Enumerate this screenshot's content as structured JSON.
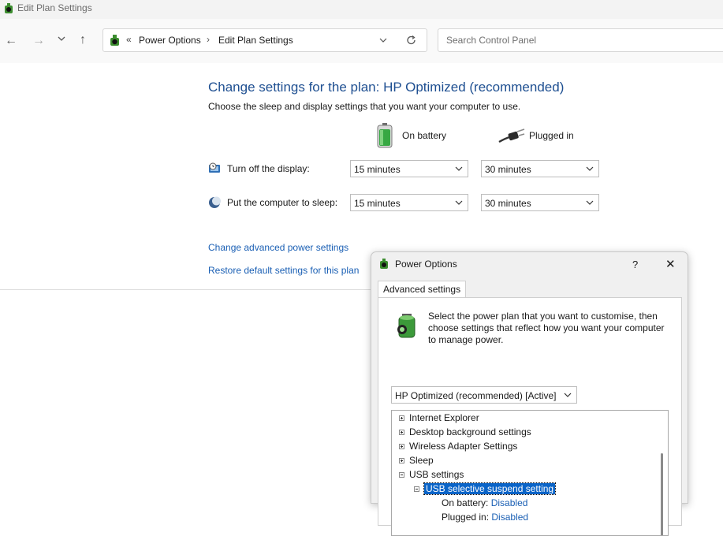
{
  "window": {
    "title": "Edit Plan Settings"
  },
  "nav": {
    "breadcrumb": [
      "Power Options",
      "Edit Plan Settings"
    ],
    "breadcrumb_chevron": "«",
    "breadcrumb_separator": "›",
    "search_placeholder": "Search Control Panel"
  },
  "main": {
    "heading": "Change settings for the plan: HP Optimized (recommended)",
    "subheading": "Choose the sleep and display settings that you want your computer to use.",
    "col_battery": "On battery",
    "col_plugged": "Plugged in",
    "rows": [
      {
        "label": "Turn off the display:",
        "battery": "15 minutes",
        "plugged": "30 minutes"
      },
      {
        "label": "Put the computer to sleep:",
        "battery": "15 minutes",
        "plugged": "30 minutes"
      }
    ],
    "link_advanced": "Change advanced power settings",
    "link_restore": "Restore default settings for this plan"
  },
  "dialog": {
    "title": "Power Options",
    "help": "?",
    "close": "✕",
    "tab": "Advanced settings",
    "description": "Select the power plan that you want to customise, then choose settings that reflect how you want your computer to manage power.",
    "plan_select": "HP Optimized (recommended) [Active]",
    "tree": [
      {
        "label": "Internet Explorer"
      },
      {
        "label": "Desktop background settings"
      },
      {
        "label": "Wireless Adapter Settings"
      },
      {
        "label": "Sleep"
      },
      {
        "label": "USB settings"
      },
      {
        "label": "USB selective suspend setting"
      },
      {
        "label": "On battery:",
        "value": "Disabled"
      },
      {
        "label": "Plugged in:",
        "value": "Disabled"
      }
    ]
  },
  "colors": {
    "heading": "#1e4f91",
    "link": "#1a5fb4",
    "selection": "#0a64c8"
  }
}
